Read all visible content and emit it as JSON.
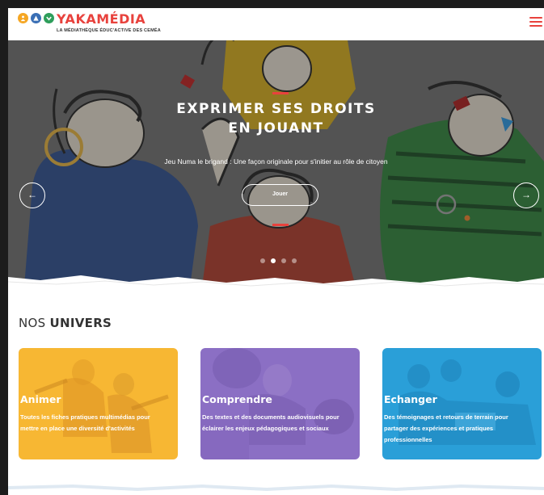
{
  "header": {
    "brand": "YAKAMÉDIA",
    "tagline": "LA MÉDIATHÈQUE ÉDUC'ACTIVE DES CEMÉA",
    "logo_dots": [
      {
        "color": "#f5a623",
        "icon": "person-icon"
      },
      {
        "color": "#3a6fb5",
        "icon": "triangle-icon"
      },
      {
        "color": "#2e9e5b",
        "icon": "chevron-icon"
      }
    ],
    "menu_icon": "hamburger-icon",
    "accent_color": "#e8423d"
  },
  "hero": {
    "title": "EXPRIMER SES DROITS\nEN JOUANT",
    "subtitle": "Jeu Numa le brigand : Une façon originale pour s'initier au rôle de citoyen",
    "button_label": "Jouer",
    "prev_arrow": "←",
    "next_arrow": "→",
    "slides_total": 4,
    "active_slide": 2
  },
  "section": {
    "title_prefix": "NOS",
    "title_bold": "UNIVERS"
  },
  "cards": [
    {
      "title": "Animer",
      "description": "Toutes les fiches pratiques multimédias pour mettre en place une diversité d'activités",
      "color": "#f7b733"
    },
    {
      "title": "Comprendre",
      "description": "Des textes et des documents audiovisuels pour éclairer les enjeux pédagogiques et sociaux",
      "color": "#8b6fc4"
    },
    {
      "title": "Echanger",
      "description": "Des témoignages et retours de terrain pour partager des expériences et pratiques professionnelles",
      "color": "#2a9fd8"
    }
  ]
}
